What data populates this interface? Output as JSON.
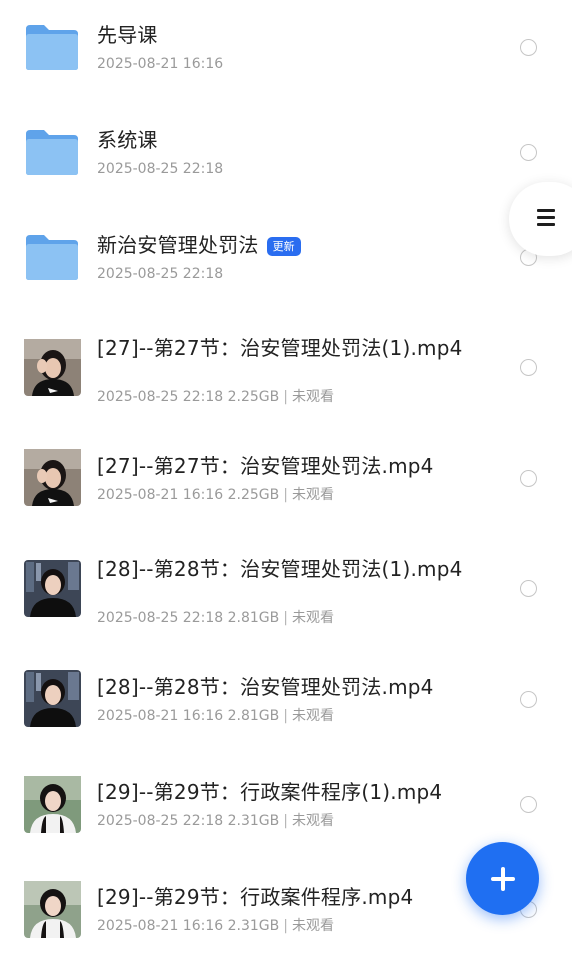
{
  "colors": {
    "accent": "#1f6ff2",
    "badge": "#2a6df0",
    "folder": "#7cb5ef",
    "title_text": "#222222",
    "meta_text": "#9a9a9a"
  },
  "side_menu": {
    "icon": "menu-icon"
  },
  "fab": {
    "icon": "plus-icon"
  },
  "items": [
    {
      "type": "folder",
      "title": "先导课",
      "date": "2025-08-21 16:16"
    },
    {
      "type": "folder",
      "title": "系统课",
      "date": "2025-08-25 22:18"
    },
    {
      "type": "folder",
      "title": "新治安管理处罚法",
      "badge": "更新",
      "date": "2025-08-25 22:18"
    },
    {
      "type": "video",
      "title": "[27]--第27节：治安管理处罚法(1).mp4",
      "date": "2025-08-25 22:18",
      "size": "2.25GB",
      "status": "未观看"
    },
    {
      "type": "video",
      "title": "[27]--第27节：治安管理处罚法.mp4",
      "date": "2025-08-21 16:16",
      "size": "2.25GB",
      "status": "未观看"
    },
    {
      "type": "video",
      "title": "[28]--第28节：治安管理处罚法(1).mp4",
      "date": "2025-08-25 22:18",
      "size": "2.81GB",
      "status": "未观看"
    },
    {
      "type": "video",
      "title": "[28]--第28节：治安管理处罚法.mp4",
      "date": "2025-08-21 16:16",
      "size": "2.81GB",
      "status": "未观看"
    },
    {
      "type": "video",
      "title": "[29]--第29节：行政案件程序(1).mp4",
      "date": "2025-08-25 22:18",
      "size": "2.31GB",
      "status": "未观看"
    },
    {
      "type": "video",
      "title": "[29]--第29节：行政案件程序.mp4",
      "date": "2025-08-21 16:16",
      "size": "2.31GB",
      "status": "未观看"
    }
  ]
}
